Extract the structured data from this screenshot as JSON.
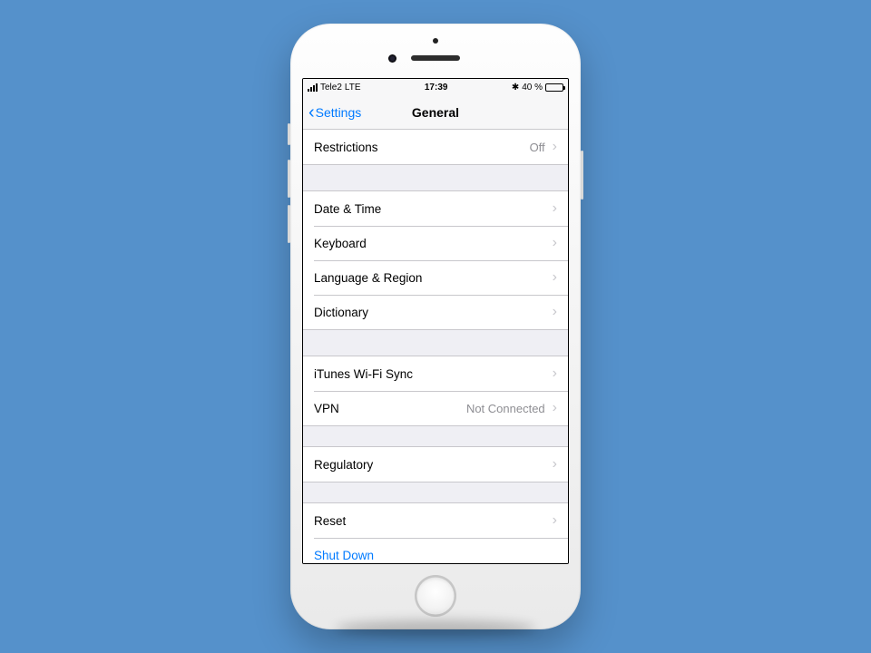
{
  "status_bar": {
    "carrier": "Tele2",
    "network": "LTE",
    "time": "17:39",
    "battery_percent": "40 %"
  },
  "nav": {
    "back_label": "Settings",
    "title": "General"
  },
  "groups": [
    {
      "rows": [
        {
          "label": "Restrictions",
          "value": "Off"
        }
      ]
    },
    {
      "rows": [
        {
          "label": "Date & Time"
        },
        {
          "label": "Keyboard"
        },
        {
          "label": "Language & Region"
        },
        {
          "label": "Dictionary"
        }
      ]
    },
    {
      "rows": [
        {
          "label": "iTunes Wi-Fi Sync"
        },
        {
          "label": "VPN",
          "value": "Not Connected"
        }
      ]
    },
    {
      "rows": [
        {
          "label": "Regulatory"
        }
      ]
    },
    {
      "rows": [
        {
          "label": "Reset"
        },
        {
          "label": "Shut Down",
          "action": true,
          "no_chevron": true
        }
      ]
    }
  ]
}
